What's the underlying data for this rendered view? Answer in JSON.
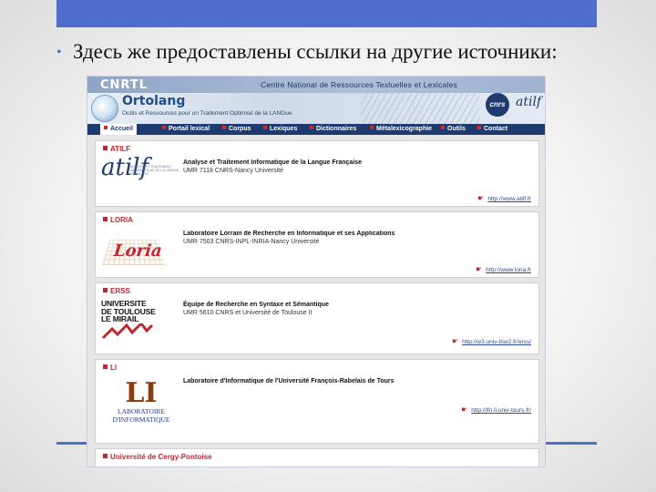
{
  "slide": {
    "bullet_text": "Здесь же предоставлены ссылки на другие источники:",
    "accent_color": "#4f6fcb"
  },
  "site": {
    "logo_text": "CNRTL",
    "full_name": "Centre National de Ressources Textuelles et Lexicales",
    "ortolang_title": "Ortolang",
    "ortolang_subtitle": "Outils et Ressources pour un Traitement Optimisé de la LANGue",
    "cnrs_logo": "cnrs",
    "atilf_logo": "atilf",
    "nav": [
      {
        "label": "Accueil"
      },
      {
        "label": "Portail lexical"
      },
      {
        "label": "Corpus"
      },
      {
        "label": "Lexiques"
      },
      {
        "label": "Dictionnaires"
      },
      {
        "label": "Métalexicographie"
      },
      {
        "label": "Outils"
      },
      {
        "label": "Contact"
      }
    ]
  },
  "partners": [
    {
      "name": "ATILF",
      "logo_text": "atilf",
      "logo_subtitle": "ANALYSE ET TRAITEMENT INFORMATIQUE DE LA LANGUE FRANÇAISE",
      "title": "Analyse et Traitement Informatique de la Langue Française",
      "unit": "UMR 7118 CNRS-Nancy Université",
      "url": "http://www.atilf.fr"
    },
    {
      "name": "LORIA",
      "logo_text": "Loria",
      "title": "Laboratoire Lorrain de Recherche en Informatique et ses Applications",
      "unit": "UMR 7503 CNRS-INPL-INRIA-Nancy Université",
      "url": "http://www.loria.fr"
    },
    {
      "name": "ERSS",
      "logo_lines": [
        "UNIVERSITE",
        "DE TOULOUSE",
        "LE MIRAIL"
      ],
      "title": "Équipe de Recherche en Syntaxe et Sémantique",
      "unit": "UMR 5610 CNRS et Université de Toulouse II",
      "url": "http://w3.univ-tlse2.fr/erss/"
    },
    {
      "name": "LI",
      "logo_big": "LI",
      "logo_lines": [
        "LABORATOIRE",
        "D'INFORMATIQUE"
      ],
      "title": "Laboratoire d'Informatique de l'Université François-Rabelais de Tours",
      "unit": "",
      "url": "http://lfn.li.univ-tours.fr/"
    },
    {
      "name": "Université de Cergy-Pontoise"
    }
  ]
}
